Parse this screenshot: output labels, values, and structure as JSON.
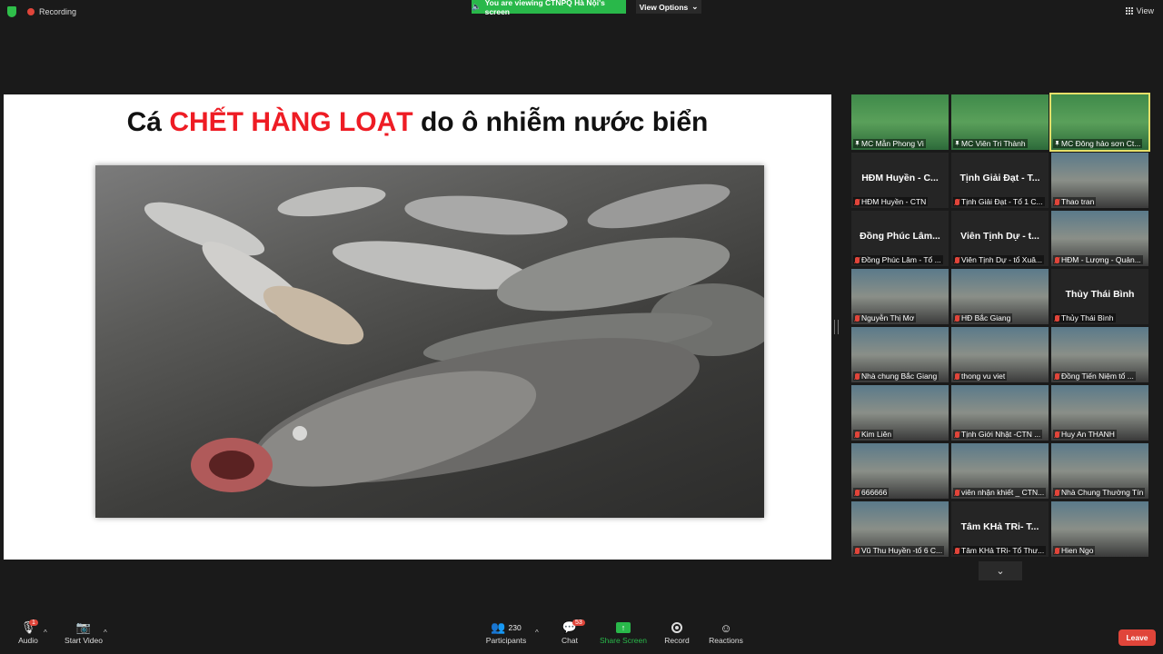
{
  "topbar": {
    "recording_label": "Recording",
    "viewing_banner": "You are viewing CTNPQ Hà Nội's screen",
    "view_options_label": "View Options",
    "view_label": "View"
  },
  "slide": {
    "title_prefix": "Cá ",
    "title_highlight": "CHẾT HÀNG LOẠT",
    "title_suffix": " do ô nhiễm nước biển"
  },
  "gallery": {
    "tiles": [
      {
        "name": "MC Mẫn Phong Vi",
        "big": "",
        "kind": "green",
        "pinned": true
      },
      {
        "name": "MC Viên Tri Thành",
        "big": "",
        "kind": "green",
        "pinned": true
      },
      {
        "name": "MC Đông hảo sơn Ct...",
        "big": "",
        "kind": "green",
        "pinned": true,
        "active": true
      },
      {
        "name": "HĐM Huyền - CTN",
        "big": "HĐM Huyền - C...",
        "kind": "dark"
      },
      {
        "name": "Tịnh Giải Đạt - Tổ 1 C...",
        "big": "Tịnh Giải Đạt - T...",
        "kind": "dark"
      },
      {
        "name": "Thao tran",
        "big": "",
        "kind": "video"
      },
      {
        "name": "Đồng Phúc Lâm - Tổ ...",
        "big": "Đồng Phúc Lâm...",
        "kind": "dark"
      },
      {
        "name": "Viên Tịnh Dự - tổ Xuâ...",
        "big": "Viên Tịnh Dự - t...",
        "kind": "dark"
      },
      {
        "name": "HĐM - Lượng - Quản...",
        "big": "",
        "kind": "video"
      },
      {
        "name": "Nguyễn Thị Mơ",
        "big": "",
        "kind": "video"
      },
      {
        "name": "HĐ Bắc Giang",
        "big": "",
        "kind": "video"
      },
      {
        "name": "Thủy Thái Bình",
        "big": "Thủy Thái Bình",
        "kind": "dark"
      },
      {
        "name": "Nhà chung Bắc Giang",
        "big": "",
        "kind": "video"
      },
      {
        "name": "thong vu viet",
        "big": "",
        "kind": "video"
      },
      {
        "name": "Đồng Tiến Niệm tổ ...",
        "big": "",
        "kind": "video"
      },
      {
        "name": "Kim Liên",
        "big": "",
        "kind": "video"
      },
      {
        "name": "Tịnh Giới Nhật -CTN ...",
        "big": "",
        "kind": "video"
      },
      {
        "name": "Huy An THANH",
        "big": "",
        "kind": "video"
      },
      {
        "name": "666666",
        "big": "",
        "kind": "video"
      },
      {
        "name": "viên nhận khiết _ CTN...",
        "big": "",
        "kind": "video"
      },
      {
        "name": "Nhà Chung Thường Tín",
        "big": "",
        "kind": "video"
      },
      {
        "name": "Vũ Thu Huyền -tổ 6 C...",
        "big": "",
        "kind": "video"
      },
      {
        "name": "Tâm KHả TRi- Tổ Thư...",
        "big": "Tâm KHả TRi- T...",
        "kind": "dark"
      },
      {
        "name": "Hien Ngo",
        "big": "",
        "kind": "video"
      }
    ]
  },
  "toolbar": {
    "audio_label": "Audio",
    "audio_badge": "1",
    "video_label": "Start Video",
    "participants_label": "Participants",
    "participants_count": "230",
    "chat_label": "Chat",
    "chat_badge": "53",
    "share_label": "Share Screen",
    "record_label": "Record",
    "reactions_label": "Reactions",
    "leave_label": "Leave"
  },
  "colors": {
    "accent_green": "#29b84a",
    "alert_red": "#e0453a",
    "title_red": "#ee1c24",
    "active_speaker": "#e6e06a"
  }
}
